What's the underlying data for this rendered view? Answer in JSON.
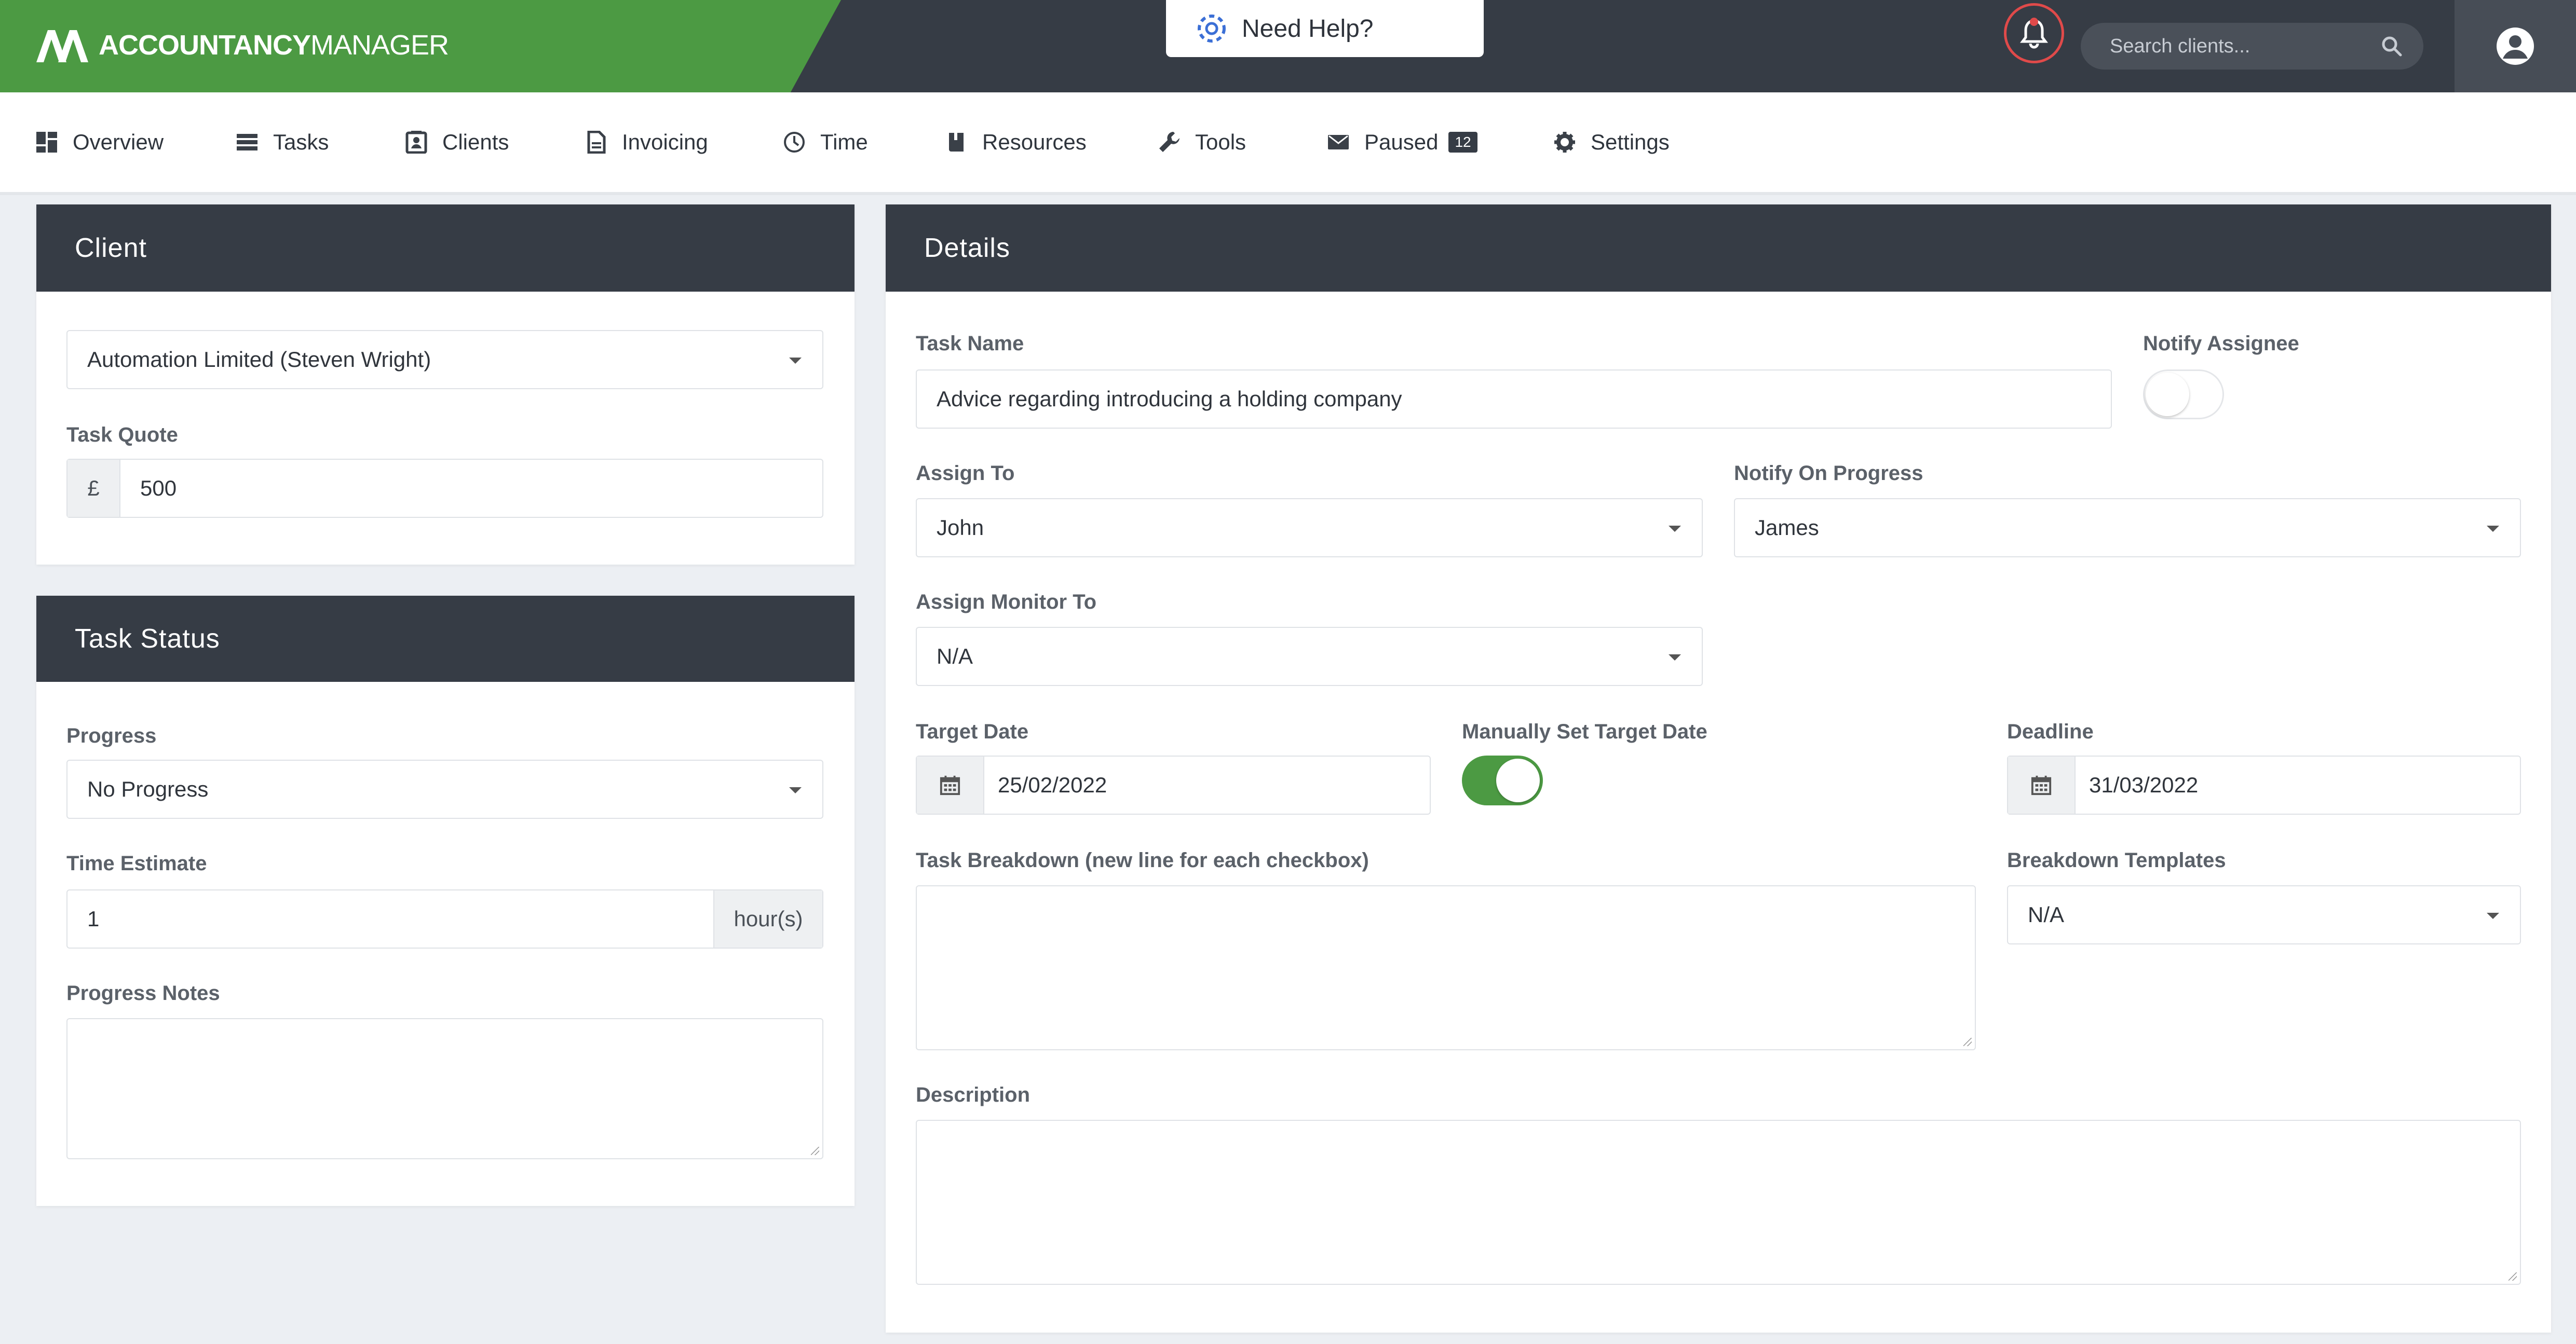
{
  "brand": {
    "name_bold": "ACCOUNTANCY",
    "name_light": "MANAGER"
  },
  "help": {
    "label": "Need Help?"
  },
  "search": {
    "placeholder": "Search clients..."
  },
  "nav": {
    "items": [
      {
        "label": "Overview",
        "icon": "dashboard-icon"
      },
      {
        "label": "Tasks",
        "icon": "list-icon"
      },
      {
        "label": "Clients",
        "icon": "contact-card-icon"
      },
      {
        "label": "Invoicing",
        "icon": "document-icon"
      },
      {
        "label": "Time",
        "icon": "clock-icon"
      },
      {
        "label": "Resources",
        "icon": "book-icon"
      },
      {
        "label": "Tools",
        "icon": "wrench-icon"
      },
      {
        "label": "Paused",
        "icon": "envelope-icon",
        "badge": "12"
      },
      {
        "label": "Settings",
        "icon": "gear-icon"
      }
    ]
  },
  "client_panel": {
    "title": "Client",
    "client_value": "Automation Limited (Steven Wright)",
    "quote_label": "Task Quote",
    "currency": "£",
    "quote_value": "500"
  },
  "status_panel": {
    "title": "Task Status",
    "progress_label": "Progress",
    "progress_value": "No Progress",
    "estimate_label": "Time Estimate",
    "estimate_value": "1",
    "estimate_unit": "hour(s)",
    "notes_label": "Progress Notes"
  },
  "details_panel": {
    "title": "Details",
    "task_name_label": "Task Name",
    "task_name_value": "Advice regarding introducing a holding company",
    "notify_assignee_label": "Notify Assignee",
    "notify_assignee_on": false,
    "assign_to_label": "Assign To",
    "assign_to_value": "John",
    "notify_progress_label": "Notify On Progress",
    "notify_progress_value": "James",
    "monitor_label": "Assign Monitor To",
    "monitor_value": "N/A",
    "target_date_label": "Target Date",
    "target_date_value": "25/02/2022",
    "manual_target_label": "Manually Set Target Date",
    "manual_target_on": true,
    "deadline_label": "Deadline",
    "deadline_value": "31/03/2022",
    "breakdown_label": "Task Breakdown (new line for each checkbox)",
    "templates_label": "Breakdown Templates",
    "templates_value": "N/A",
    "description_label": "Description"
  },
  "colors": {
    "brand_green": "#4c9a43",
    "dark_bar": "#363c45",
    "alert_red": "#e04a4a"
  }
}
